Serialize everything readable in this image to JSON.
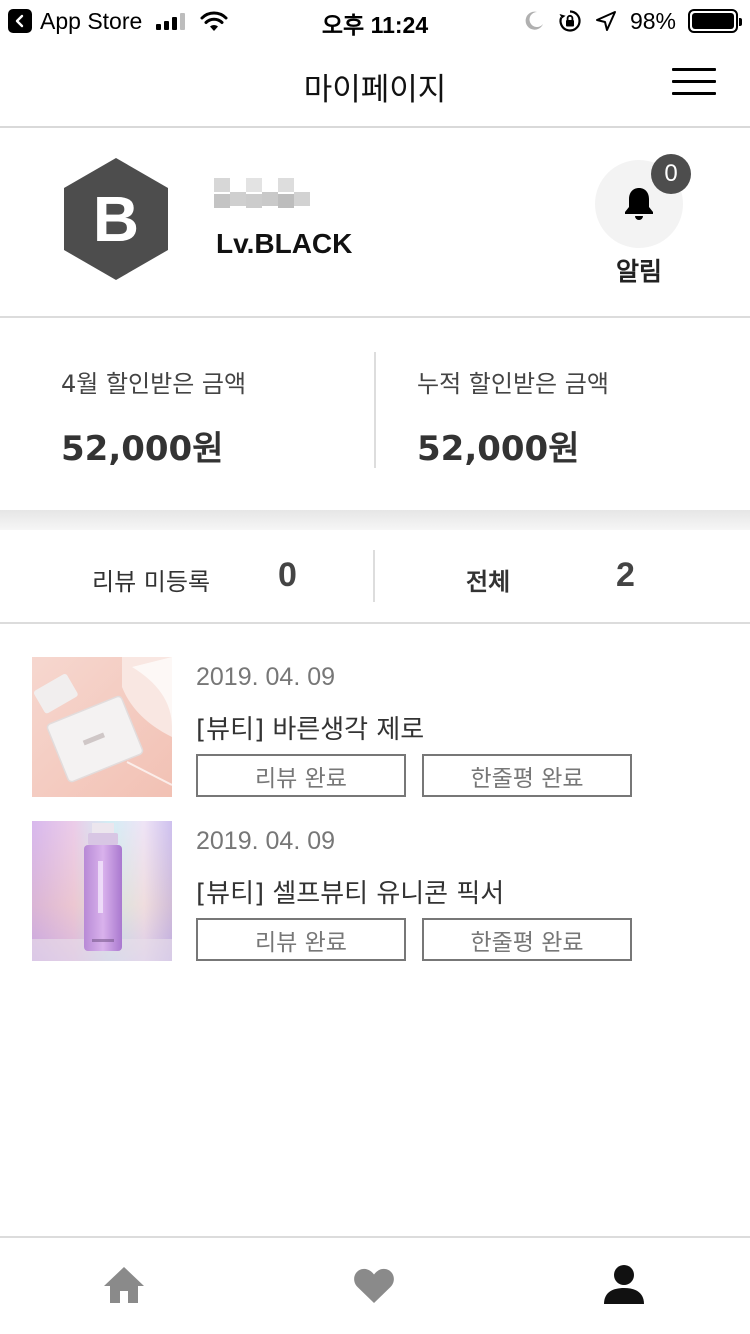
{
  "status_bar": {
    "back_app": "App Store",
    "time": "오후 11:24",
    "battery": "98%"
  },
  "header": {
    "title": "마이페이지"
  },
  "profile": {
    "avatar_letter": "B",
    "level": "Lv.BLACK",
    "notification_count": "0",
    "notification_label": "알림"
  },
  "discount": {
    "month_label": "4월 할인받은 금액",
    "month_value": "52,000원",
    "total_label": "누적 할인받은 금액",
    "total_value": "52,000원"
  },
  "review_counts": {
    "unregistered_label": "리뷰 미등록",
    "unregistered_value": "0",
    "all_label": "전체",
    "all_value": "2"
  },
  "items": [
    {
      "date": "2019. 04. 09",
      "title": "[뷰티] 바른생각 제로",
      "review_button": "리뷰 완료",
      "oneline_button": "한줄평 완료"
    },
    {
      "date": "2019. 04. 09",
      "title": "[뷰티] 셀프뷰티 유니콘 픽서",
      "review_button": "리뷰 완료",
      "oneline_button": "한줄평 완료"
    }
  ],
  "icons": {
    "back": "back-arrow-icon",
    "signal": "signal-icon",
    "wifi": "wifi-icon",
    "moon": "moon-icon",
    "rotation_lock": "rotation-lock-icon",
    "location": "location-arrow-icon",
    "battery": "battery-icon",
    "menu": "hamburger-menu-icon",
    "bell": "bell-icon",
    "home": "home-icon",
    "heart": "heart-icon",
    "user": "user-icon"
  },
  "colors": {
    "avatar_hex": "#4d4d4d",
    "badge": "#4d4d4d",
    "nav_inactive": "#8a8a8a",
    "nav_active": "#111111"
  }
}
